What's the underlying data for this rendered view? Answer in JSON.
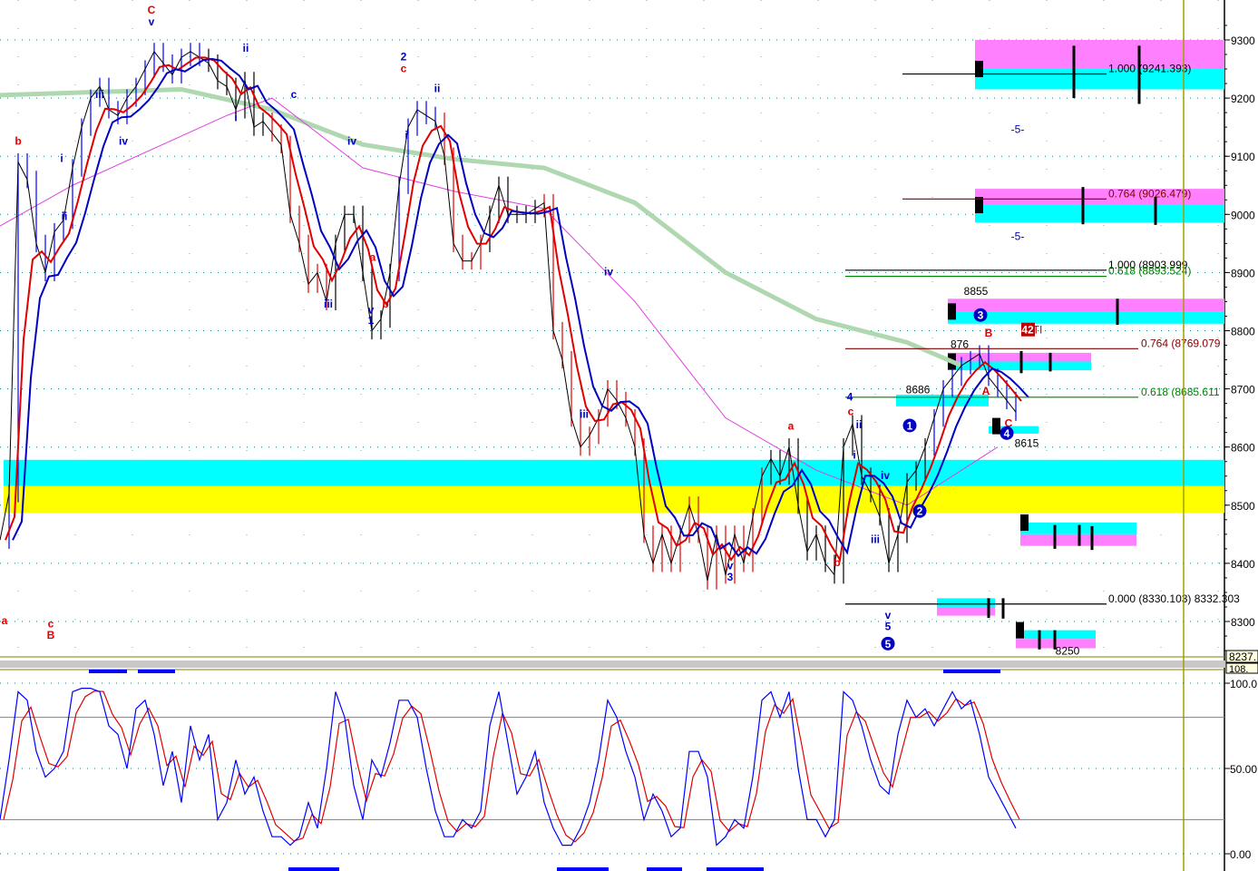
{
  "chart_data": [
    {
      "type": "line",
      "title": "Price with Elliott wave counts",
      "ylim": [
        8237,
        9360
      ],
      "y_ticks": [
        9300,
        9200,
        9100,
        9000,
        8900,
        8800,
        8700,
        8600,
        8500,
        8400,
        8300
      ],
      "y_tick_labels": [
        "9300",
        "9200",
        "9100",
        "9000",
        "8900",
        "8800",
        "8700",
        "8600",
        "8500",
        "8400",
        "8300"
      ],
      "axis_readout": "8237.",
      "grid": true,
      "x_step": 1,
      "close": [
        8440,
        8520,
        9090,
        9060,
        8950,
        8900,
        8970,
        8990,
        9080,
        9150,
        9200,
        9220,
        9180,
        9170,
        9200,
        9220,
        9250,
        9280,
        9260,
        9240,
        9270,
        9280,
        9270,
        9260,
        9230,
        9220,
        9180,
        9230,
        9150,
        9160,
        9140,
        9120,
        9000,
        8950,
        8880,
        8900,
        8850,
        8950,
        9000,
        9000,
        8900,
        8800,
        8820,
        8900,
        9050,
        9150,
        9180,
        9170,
        9160,
        9100,
        8950,
        8920,
        8920,
        8950,
        9000,
        9050,
        9000,
        9000,
        9000,
        9010,
        9020,
        8800,
        8750,
        8650,
        8600,
        8620,
        8650,
        8700,
        8680,
        8650,
        8600,
        8450,
        8400,
        8450,
        8400,
        8450,
        8500,
        8450,
        8370,
        8450,
        8380,
        8450,
        8400,
        8480,
        8550,
        8580,
        8550,
        8600,
        8500,
        8420,
        8450,
        8400,
        8380,
        8600,
        8640,
        8550,
        8520,
        8480,
        8400,
        8450,
        8540,
        8560,
        8600,
        8650,
        8700,
        8720,
        8740,
        8750,
        8760,
        8720,
        8700,
        8680,
        8660
      ],
      "ma_long": [
        [
          0,
          9205
        ],
        [
          20,
          9215
        ],
        [
          30,
          9180
        ],
        [
          40,
          9120
        ],
        [
          50,
          9095
        ],
        [
          60,
          9080
        ],
        [
          70,
          9020
        ],
        [
          80,
          8900
        ],
        [
          90,
          8820
        ],
        [
          100,
          8780
        ],
        [
          106,
          8740
        ]
      ],
      "ma_mid": [
        [
          0,
          8980
        ],
        [
          8,
          9050
        ],
        [
          25,
          9170
        ],
        [
          30,
          9200
        ],
        [
          40,
          9080
        ],
        [
          50,
          9040
        ],
        [
          60,
          9010
        ],
        [
          70,
          8850
        ],
        [
          80,
          8650
        ],
        [
          90,
          8560
        ],
        [
          100,
          8500
        ],
        [
          110,
          8600
        ]
      ],
      "zones": [
        {
          "from": 0.4,
          "to": 135,
          "low": 8533,
          "high": 8578,
          "color": "#00ffff"
        },
        {
          "from": 0.4,
          "to": 135,
          "low": 8487,
          "high": 8533,
          "color": "#ffff00"
        },
        {
          "from": 107.5,
          "to": 135,
          "low": 9250,
          "high": 9300,
          "color": "#ff80ff"
        },
        {
          "from": 107.5,
          "to": 135,
          "low": 9215,
          "high": 9250,
          "color": "#00ffff"
        },
        {
          "from": 107.5,
          "to": 135,
          "low": 9016,
          "high": 9044,
          "color": "#ff80ff"
        },
        {
          "from": 107.5,
          "to": 135,
          "low": 8986,
          "high": 9016,
          "color": "#00ffff"
        },
        {
          "from": 104.5,
          "to": 135,
          "low": 8833,
          "high": 8855,
          "color": "#ff80ff"
        },
        {
          "from": 104.5,
          "to": 135,
          "low": 8812,
          "high": 8833,
          "color": "#00ffff"
        },
        {
          "from": 104.5,
          "to": 120.3,
          "low": 8747,
          "high": 8762,
          "color": "#ff80ff"
        },
        {
          "from": 104.5,
          "to": 120.3,
          "low": 8732,
          "high": 8747,
          "color": "#00ffff"
        },
        {
          "from": 98.8,
          "to": 109,
          "low": 8670,
          "high": 8690,
          "color": "#00ffff"
        },
        {
          "from": 109,
          "to": 114.5,
          "low": 8623,
          "high": 8636,
          "color": "#00ffff"
        },
        {
          "from": 112.5,
          "to": 125.3,
          "low": 8450,
          "high": 8470,
          "color": "#00ffff"
        },
        {
          "from": 112.5,
          "to": 125.3,
          "low": 8430,
          "high": 8450,
          "color": "#ff80ff"
        },
        {
          "from": 103.3,
          "to": 109.7,
          "low": 8325,
          "high": 8340,
          "color": "#00ffff"
        },
        {
          "from": 103.3,
          "to": 109.7,
          "low": 8310,
          "high": 8325,
          "color": "#ff80ff"
        },
        {
          "from": 112,
          "to": 120.8,
          "low": 8270,
          "high": 8285,
          "color": "#00ffff"
        },
        {
          "from": 112,
          "to": 120.8,
          "low": 8254,
          "high": 8270,
          "color": "#ff80ff"
        }
      ],
      "fib_levels": [
        {
          "label": "1.000 (9241.393)",
          "value": 9241.393,
          "from": 99.5,
          "to": 122,
          "color": "#000000"
        },
        {
          "label": "0.764 (9026.479)",
          "value": 9026.479,
          "from": 99.5,
          "to": 122,
          "color": "#800000"
        },
        {
          "label": "1.000 (8903.999",
          "value": 8903.999,
          "from": 93.2,
          "to": 122,
          "color": "#000000"
        },
        {
          "label": "0.618 (8893.524)",
          "value": 8893.524,
          "from": 93.2,
          "to": 122,
          "color": "#008000"
        },
        {
          "label": "0.764 (8769.079",
          "value": 8769.079,
          "from": 93.2,
          "to": 125.5,
          "color": "#800000"
        },
        {
          "label": "0.618 (8685.611",
          "value": 8685.611,
          "from": 93.2,
          "to": 125.5,
          "color": "#008000"
        },
        {
          "label": "0.000 (8330.103) 8332.303",
          "value": 8330,
          "from": 93.2,
          "to": 122,
          "color": "#000000"
        }
      ],
      "price_labels": [
        {
          "text": "8855",
          "x": 107.6,
          "price": 8862,
          "color": "#000000"
        },
        {
          "text": "876",
          "x": 105.8,
          "price": 8770,
          "color": "#000000"
        },
        {
          "text": "8686",
          "x": 101.2,
          "price": 8692,
          "color": "#000000"
        },
        {
          "text": "8615",
          "x": 113.2,
          "price": 8600,
          "color": "#000000"
        },
        {
          "text": "8250",
          "x": 117.7,
          "price": 8243,
          "color": "#000000"
        },
        {
          "text": "-5-",
          "x": 112.2,
          "price": 9140,
          "color": "#0000c0"
        },
        {
          "text": "-5-",
          "x": 112.2,
          "price": 8956,
          "color": "#0000c0"
        },
        {
          "text": "PTI",
          "x": 114,
          "price": 8795,
          "color": "#c00000"
        }
      ],
      "wave_labels": [
        {
          "text": "a",
          "x": 0.5,
          "price": 8295,
          "color": "#e00000"
        },
        {
          "text": "b",
          "x": 2,
          "price": 9120,
          "color": "#e00000"
        },
        {
          "text": "i",
          "x": 6.8,
          "price": 9090,
          "color": "#0000c0"
        },
        {
          "text": "ii",
          "x": 7.1,
          "price": 8990,
          "color": "#0000c0"
        },
        {
          "text": "c",
          "x": 5.6,
          "price": 8290,
          "color": "#e00000"
        },
        {
          "text": "B",
          "x": 5.6,
          "price": 8270,
          "color": "#e00000"
        },
        {
          "text": "iii",
          "x": 11,
          "price": 9200,
          "color": "#0000c0"
        },
        {
          "text": "iv",
          "x": 13.6,
          "price": 9120,
          "color": "#0000c0"
        },
        {
          "text": "C",
          "x": 16.7,
          "price": 9345,
          "color": "#e00000"
        },
        {
          "text": "v",
          "x": 16.7,
          "price": 9325,
          "color": "#0000c0"
        },
        {
          "text": "ii",
          "x": 27.1,
          "price": 9280,
          "color": "#0000c0"
        },
        {
          "text": "i",
          "x": 26,
          "price": 9160,
          "color": "#0000c0"
        },
        {
          "text": "iv",
          "x": 38.8,
          "price": 9120,
          "color": "#0000c0"
        },
        {
          "text": "iii",
          "x": 36.2,
          "price": 8840,
          "color": "#0000c0"
        },
        {
          "text": "v",
          "x": 40.9,
          "price": 8830,
          "color": "#0000c0"
        },
        {
          "text": "1",
          "x": 40.9,
          "price": 8812,
          "color": "#0000c0"
        },
        {
          "text": "b",
          "x": 42.5,
          "price": 8840,
          "color": "#e00000"
        },
        {
          "text": "a",
          "x": 41.1,
          "price": 8920,
          "color": "#e00000"
        },
        {
          "text": "2",
          "x": 44.5,
          "price": 9265,
          "color": "#0000c0"
        },
        {
          "text": "c",
          "x": 44.5,
          "price": 9245,
          "color": "#e00000"
        },
        {
          "text": "i",
          "x": 44.8,
          "price": 9130,
          "color": "#0000c0"
        },
        {
          "text": "ii",
          "x": 48.2,
          "price": 9210,
          "color": "#0000c0"
        },
        {
          "text": "c",
          "x": 32.4,
          "price": 9200,
          "color": "#0000c0"
        },
        {
          "text": "iv",
          "x": 67.1,
          "price": 8895,
          "color": "#0000c0"
        },
        {
          "text": "iii",
          "x": 64.4,
          "price": 8650,
          "color": "#0000c0"
        },
        {
          "text": "v",
          "x": 80.5,
          "price": 8390,
          "color": "#0000c0"
        },
        {
          "text": "3",
          "x": 80.5,
          "price": 8370,
          "color": "#0000c0"
        },
        {
          "text": "a",
          "x": 87.2,
          "price": 8630,
          "color": "#e00000"
        },
        {
          "text": "b",
          "x": 92.3,
          "price": 8395,
          "color": "#e00000"
        },
        {
          "text": "4",
          "x": 93.7,
          "price": 8680,
          "color": "#0000c0"
        },
        {
          "text": "c",
          "x": 93.8,
          "price": 8655,
          "color": "#e00000"
        },
        {
          "text": "i",
          "x": 94.2,
          "price": 8580,
          "color": "#0000c0"
        },
        {
          "text": "ii",
          "x": 94.7,
          "price": 8632,
          "color": "#0000c0"
        },
        {
          "text": "iv",
          "x": 97.6,
          "price": 8545,
          "color": "#0000c0"
        },
        {
          "text": "iii",
          "x": 96.5,
          "price": 8435,
          "color": "#0000c0"
        },
        {
          "text": "v",
          "x": 97.9,
          "price": 8305,
          "color": "#0000c0"
        },
        {
          "text": "5",
          "x": 97.9,
          "price": 8285,
          "color": "#0000c0"
        },
        {
          "text": "B",
          "x": 109,
          "price": 8790,
          "color": "#e00000"
        },
        {
          "text": "A",
          "x": 108.7,
          "price": 8690,
          "color": "#e00000"
        },
        {
          "text": "C",
          "x": 111.2,
          "price": 8635,
          "color": "#e00000"
        }
      ],
      "circle_labels": [
        {
          "text": "1",
          "x": 100.3,
          "price": 8637
        },
        {
          "text": "2",
          "x": 101.4,
          "price": 8490
        },
        {
          "text": "3",
          "x": 108.1,
          "price": 8827
        },
        {
          "text": "4",
          "x": 111,
          "price": 8624
        },
        {
          "text": "5",
          "x": 97.9,
          "price": 8262
        }
      ],
      "box_label": {
        "text": "42",
        "x": 113.3,
        "price": 8795
      }
    },
    {
      "type": "line",
      "title": "Stochastic oscillator",
      "ylim": [
        -5,
        105
      ],
      "y_ticks": [
        100,
        50,
        0
      ],
      "y_tick_labels": [
        "100.0",
        "50.00",
        "0.00"
      ],
      "axis_readout": "108.",
      "levels": [
        80,
        20
      ],
      "k": [
        20,
        55,
        95,
        90,
        60,
        45,
        50,
        60,
        95,
        97,
        97,
        95,
        75,
        70,
        50,
        85,
        90,
        70,
        40,
        60,
        30,
        75,
        55,
        70,
        20,
        30,
        55,
        35,
        45,
        25,
        10,
        10,
        5,
        10,
        30,
        15,
        50,
        95,
        80,
        40,
        20,
        55,
        45,
        65,
        90,
        90,
        80,
        50,
        25,
        10,
        10,
        20,
        15,
        25,
        75,
        95,
        65,
        35,
        45,
        60,
        30,
        15,
        5,
        5,
        15,
        30,
        55,
        90,
        80,
        60,
        45,
        20,
        35,
        25,
        10,
        15,
        60,
        60,
        45,
        5,
        10,
        20,
        15,
        45,
        90,
        95,
        80,
        95,
        50,
        20,
        20,
        10,
        20,
        95,
        90,
        75,
        55,
        40,
        35,
        70,
        90,
        80,
        85,
        75,
        85,
        95,
        85,
        90,
        70,
        45,
        35,
        25,
        15
      ]
    }
  ]
}
